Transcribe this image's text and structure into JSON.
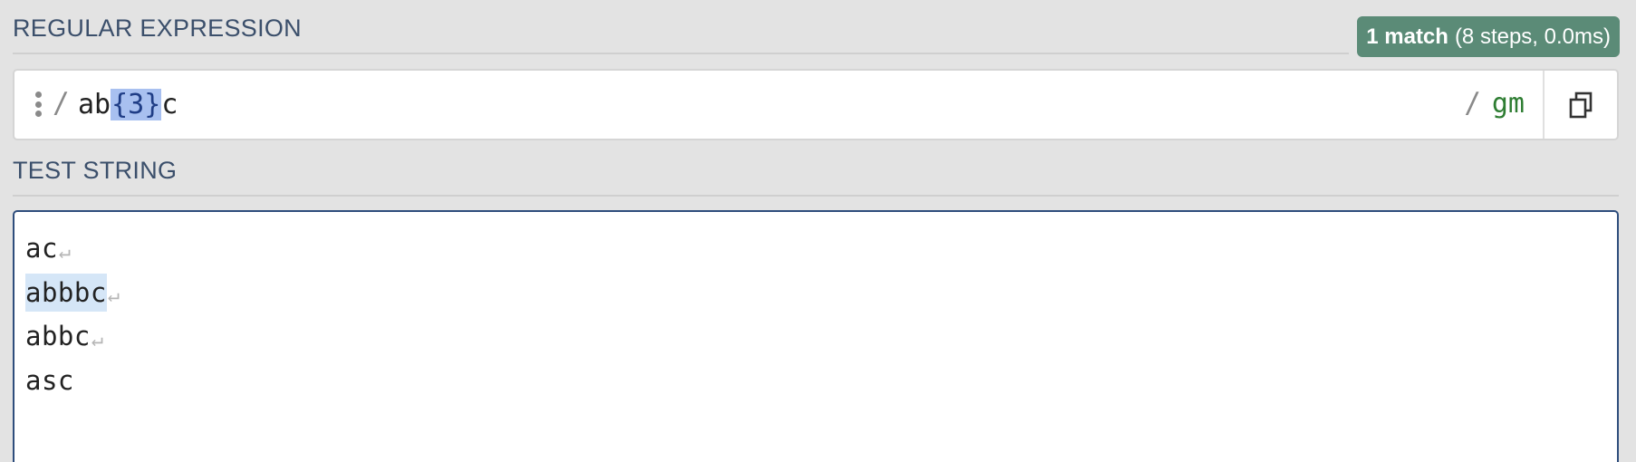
{
  "regex_section": {
    "title": "REGULAR EXPRESSION"
  },
  "match_info": {
    "count": "1 match",
    "detail": "(8 steps, 0.0ms)"
  },
  "regex": {
    "open_delimiter": "/",
    "before": "ab",
    "quantifier": "{3}",
    "after": "c",
    "close_delimiter": "/",
    "flags": "gm"
  },
  "test_section": {
    "title": "TEST STRING"
  },
  "test_string": {
    "lines": [
      {
        "text": "ac",
        "newline": "↵"
      },
      {
        "text": "abbbc",
        "newline": "↵"
      },
      {
        "text": "abbc",
        "newline": "↵"
      },
      {
        "text": "asc",
        "newline": ""
      }
    ]
  },
  "icons": {
    "drag": "drag-handle-icon",
    "copy": "copy-icon",
    "newline": "newline-icon"
  },
  "colors": {
    "header_text": "#3b4f6b",
    "badge_bg": "#5b8b77",
    "quantifier_highlight": "#a8c0f0",
    "match_highlight": "#d5e6f7",
    "flags": "#2e7d32",
    "focused_border": "#2e4d7c"
  }
}
